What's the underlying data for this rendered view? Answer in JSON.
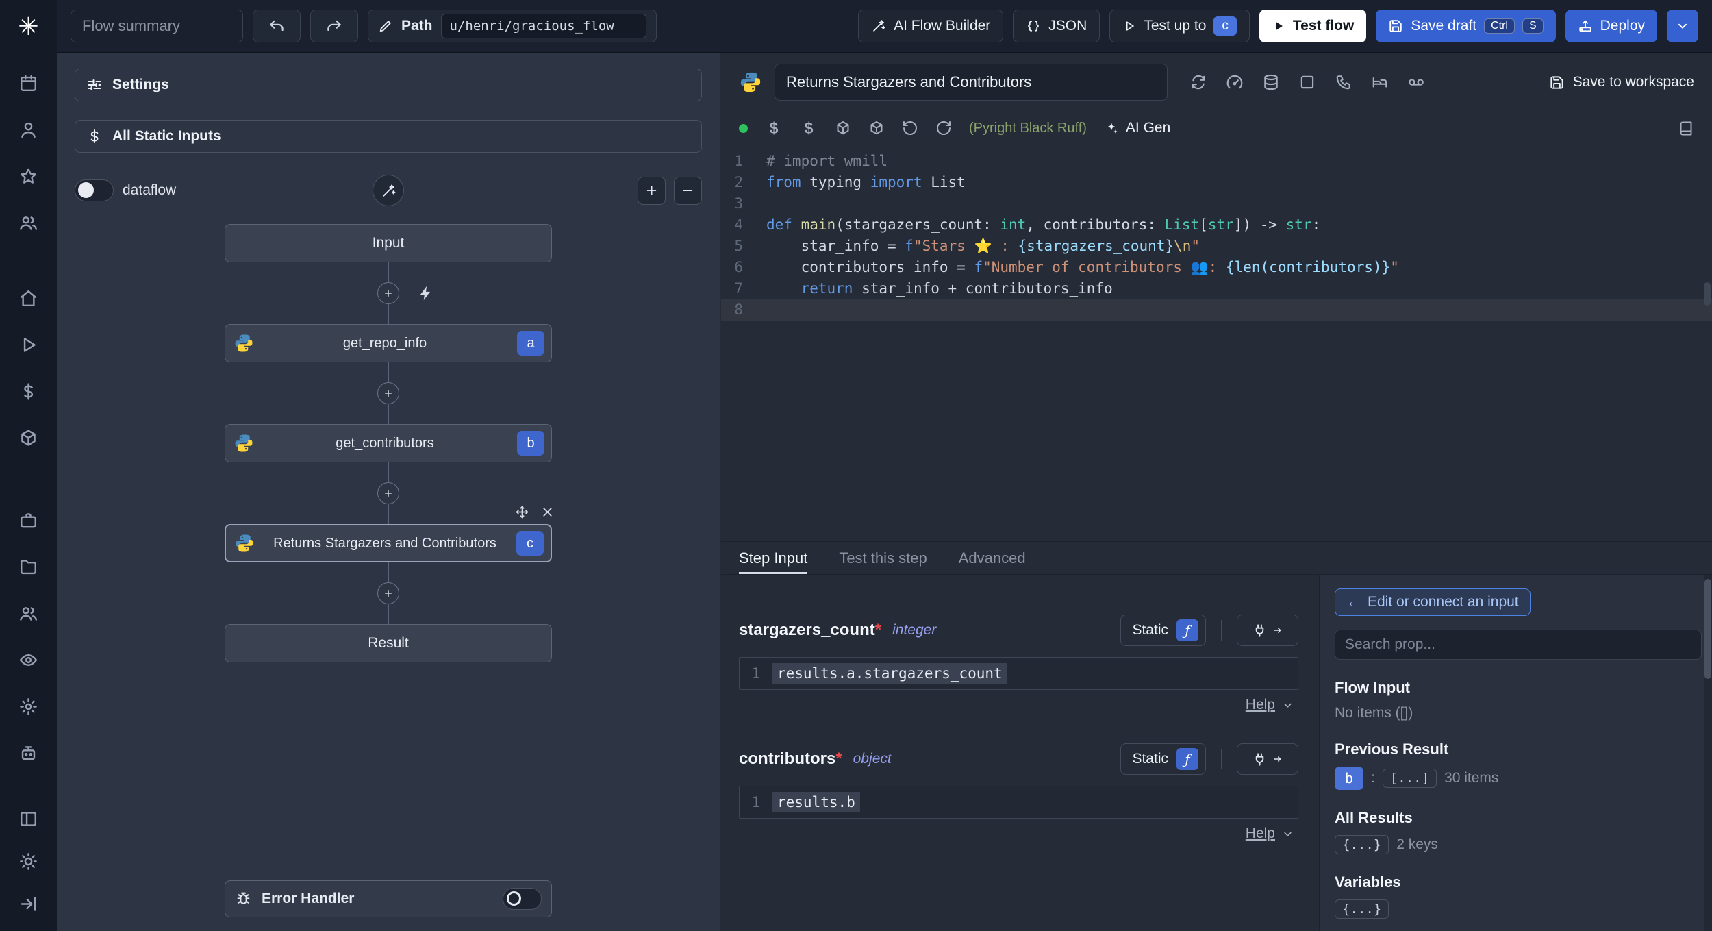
{
  "colors": {
    "accent_blue": "#3562d0",
    "badge_blue": "#3f66cc",
    "success_green": "#2fc160",
    "lint_green": "#8aa26b",
    "required_red": "#e5484d",
    "type_indigo": "#97a0f0",
    "editor_bg": "#262c37",
    "flow_panel_bg": "#2d3444",
    "rail_bg": "#141a26"
  },
  "rail_icons": [
    "windmill-logo",
    "calendar",
    "user",
    "star",
    "users",
    "home",
    "play",
    "dollar",
    "cube",
    "briefcase",
    "folder",
    "team",
    "eye",
    "gear",
    "bot",
    "columns",
    "sun",
    "arrow-right"
  ],
  "header": {
    "flow_summary": "Flow summary",
    "path_label": "Path",
    "path_value": "u/henri/gracious_flow",
    "ai_flow_builder_label": "AI Flow Builder",
    "json_label": "JSON",
    "test_up_to_label": "Test up to",
    "test_up_to_badge": "c",
    "test_flow_label": "Test flow",
    "save_draft_label": "Save draft",
    "kbd_ctrl": "Ctrl",
    "kbd_s": "S",
    "deploy_label": "Deploy"
  },
  "flow": {
    "settings_label": "Settings",
    "static_inputs_label": "All Static Inputs",
    "dataflow_label": "dataflow",
    "input_node": "Input",
    "result_node": "Result",
    "steps": [
      {
        "id": "a",
        "label": "get_repo_info"
      },
      {
        "id": "b",
        "label": "get_contributors"
      },
      {
        "id": "c",
        "label": "Returns Stargazers and Contributors"
      }
    ],
    "error_handler_label": "Error Handler"
  },
  "editor": {
    "title": "Returns Stargazers and Contributors",
    "save_to_workspace_label": "Save to workspace",
    "lint_label": "(Pyright Black Ruff)",
    "ai_gen_label": "AI Gen",
    "language": "python",
    "active_line": 8,
    "code_lines": [
      [
        {
          "t": "# import wmill",
          "c": "cm"
        }
      ],
      [
        {
          "t": "from",
          "c": "kw"
        },
        {
          "t": " typing ",
          "c": "pl"
        },
        {
          "t": "import",
          "c": "kw"
        },
        {
          "t": " List",
          "c": "pl"
        }
      ],
      [],
      [
        {
          "t": "def",
          "c": "kw"
        },
        {
          "t": " ",
          "c": "pl"
        },
        {
          "t": "main",
          "c": "fn"
        },
        {
          "t": "(stargazers_count: ",
          "c": "pl"
        },
        {
          "t": "int",
          "c": "ty"
        },
        {
          "t": ", contributors: ",
          "c": "pl"
        },
        {
          "t": "List",
          "c": "ty"
        },
        {
          "t": "[",
          "c": "pl"
        },
        {
          "t": "str",
          "c": "ty"
        },
        {
          "t": "]) -> ",
          "c": "pl"
        },
        {
          "t": "str",
          "c": "ty"
        },
        {
          "t": ":",
          "c": "pl"
        }
      ],
      [
        {
          "t": "    star_info = ",
          "c": "pl"
        },
        {
          "t": "f",
          "c": "kw"
        },
        {
          "t": "\"Stars ⭐ : ",
          "c": "st"
        },
        {
          "t": "{stargazers_count}",
          "c": "iv"
        },
        {
          "t": "\\n",
          "c": "esc"
        },
        {
          "t": "\"",
          "c": "st"
        }
      ],
      [
        {
          "t": "    contributors_info = ",
          "c": "pl"
        },
        {
          "t": "f",
          "c": "kw"
        },
        {
          "t": "\"Number of contributors 👥: ",
          "c": "st"
        },
        {
          "t": "{len(contributors)}",
          "c": "iv"
        },
        {
          "t": "\"",
          "c": "st"
        }
      ],
      [
        {
          "t": "    ",
          "c": "pl"
        },
        {
          "t": "return",
          "c": "kw"
        },
        {
          "t": " star_info + contributors_info",
          "c": "pl"
        }
      ],
      []
    ]
  },
  "step_panel": {
    "tabs": [
      "Step Input",
      "Test this step",
      "Advanced"
    ],
    "fields": [
      {
        "name": "stargazers_count",
        "required_marker": "*",
        "type": "integer",
        "mode": "Static",
        "line_no": "1",
        "expr": "results.a.stargazers_count",
        "help_label": "Help"
      },
      {
        "name": "contributors",
        "required_marker": "*",
        "type": "object",
        "mode": "Static",
        "line_no": "1",
        "expr": "results.b",
        "help_label": "Help"
      }
    ]
  },
  "props": {
    "edit_connect": "Edit or connect an input",
    "search_placeholder": "Search prop...",
    "flow_input": {
      "title": "Flow Input",
      "empty": "No items ([])"
    },
    "previous_result": {
      "title": "Previous Result",
      "badge": "b",
      "separator": ":",
      "collapsed": "[...]",
      "count": "30 items"
    },
    "all_results": {
      "title": "All Results",
      "collapsed": "{...}",
      "count": "2 keys"
    },
    "variables": {
      "title": "Variables",
      "collapsed": "{...}"
    }
  }
}
